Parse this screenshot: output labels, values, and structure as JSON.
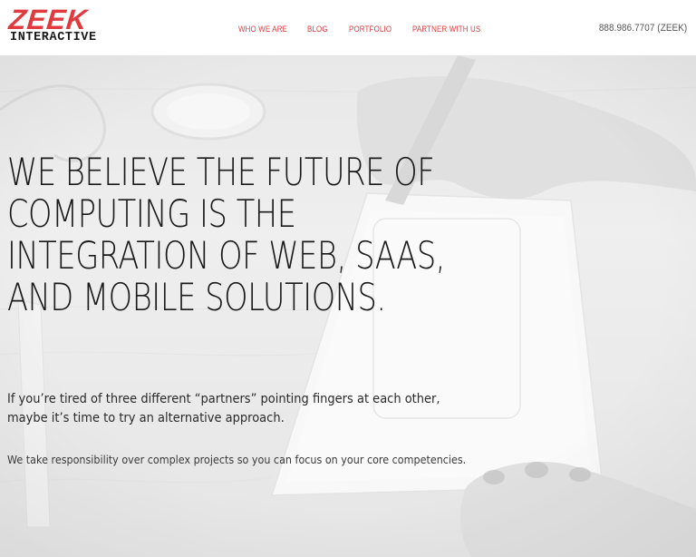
{
  "brand": {
    "name": "ZEEK",
    "subtitle": "INTERACTIVE",
    "accent": "#e03a3e"
  },
  "nav": {
    "items": [
      {
        "label": "WHO WE ARE"
      },
      {
        "label": "BLOG"
      },
      {
        "label": "PORTFOLIO"
      },
      {
        "label": "PARTNER WITH US"
      }
    ]
  },
  "header": {
    "phone": "888.986.7707 (ZEEK)"
  },
  "hero": {
    "headline_lines": [
      "WE BELIEVE THE FUTURE OF",
      "COMPUTING IS THE",
      "INTEGRATION OF WEB, SAAS,",
      "AND MOBILE SOLUTIONS."
    ],
    "lead_lines": [
      "If you’re tired of three different “partners” pointing fingers at each other,",
      "maybe it’s time to try an alternative approach."
    ],
    "sub": "We take responsibility over complex projects so you can focus on your core competencies."
  }
}
